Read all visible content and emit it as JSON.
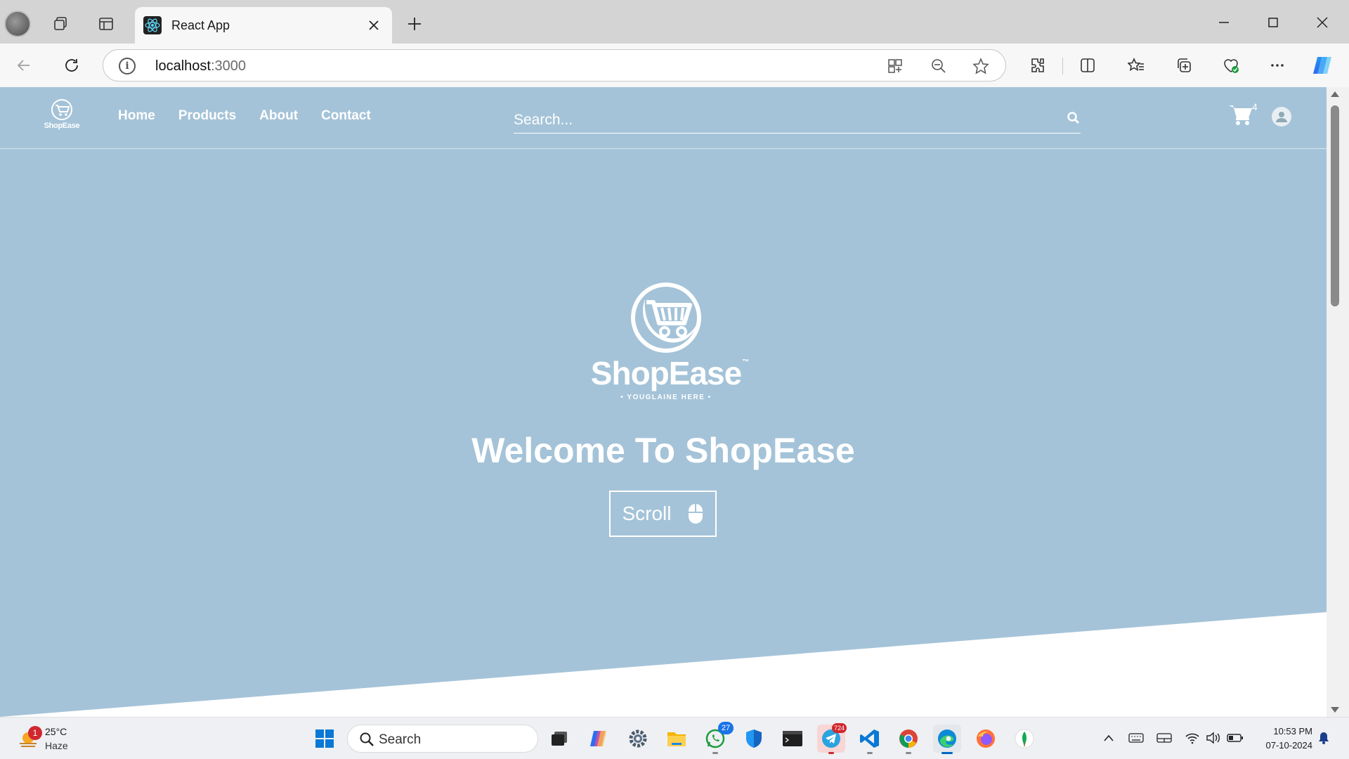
{
  "browser": {
    "tab_title": "React App",
    "url_host": "localhost",
    "url_port": ":3000"
  },
  "site": {
    "logo_text": "ShopEase",
    "nav": [
      {
        "label": "Home"
      },
      {
        "label": "Products"
      },
      {
        "label": "About"
      },
      {
        "label": "Contact"
      }
    ],
    "search_placeholder": "Search...",
    "cart_count": "4",
    "hero": {
      "brand": "ShopEase",
      "tm": "™",
      "tagline": "• YOUGLAINE HERE •",
      "title": "Welcome To ShopEase",
      "scroll_label": "Scroll"
    },
    "colors": {
      "hero_background": "#a4c3d8",
      "text": "#ffffff"
    }
  },
  "taskbar": {
    "weather_alert": "1",
    "temperature": "25°C",
    "condition": "Haze",
    "search_placeholder": "Search",
    "whatsapp_badge": "27",
    "telegram_badge": "724",
    "time": "10:53 PM",
    "date": "07-10-2024"
  }
}
